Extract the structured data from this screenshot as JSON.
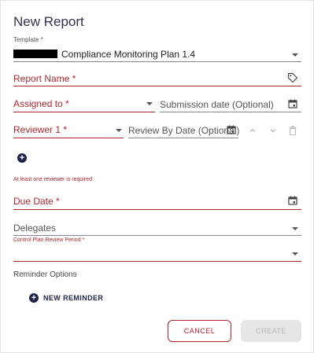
{
  "dialog": {
    "title": "New Report",
    "template": {
      "label": "Template *",
      "value": "Compliance Monitoring Plan 1.4"
    },
    "report_name": {
      "placeholder": "Report Name *"
    },
    "assigned_to": {
      "placeholder": "Assigned to *"
    },
    "submission_date": {
      "placeholder": "Submission date (Optional)"
    },
    "reviewer": {
      "placeholder": "Reviewer 1 *"
    },
    "review_by_date": {
      "placeholder": "Review By Date (Optional)"
    },
    "reviewer_error": "At least one reviewer is required",
    "due_date": {
      "placeholder": "Due Date *"
    },
    "delegates": {
      "placeholder": "Delegates"
    },
    "review_period": {
      "label": "Control Plan Review Period *"
    },
    "reminder_section": "Reminder Options",
    "new_reminder_label": "NEW REMINDER",
    "cancel_label": "CANCEL",
    "create_label": "CREATE"
  },
  "colors": {
    "accent": "#b0262e",
    "navy": "#1e2447",
    "disabled": "#e6e6e6"
  }
}
